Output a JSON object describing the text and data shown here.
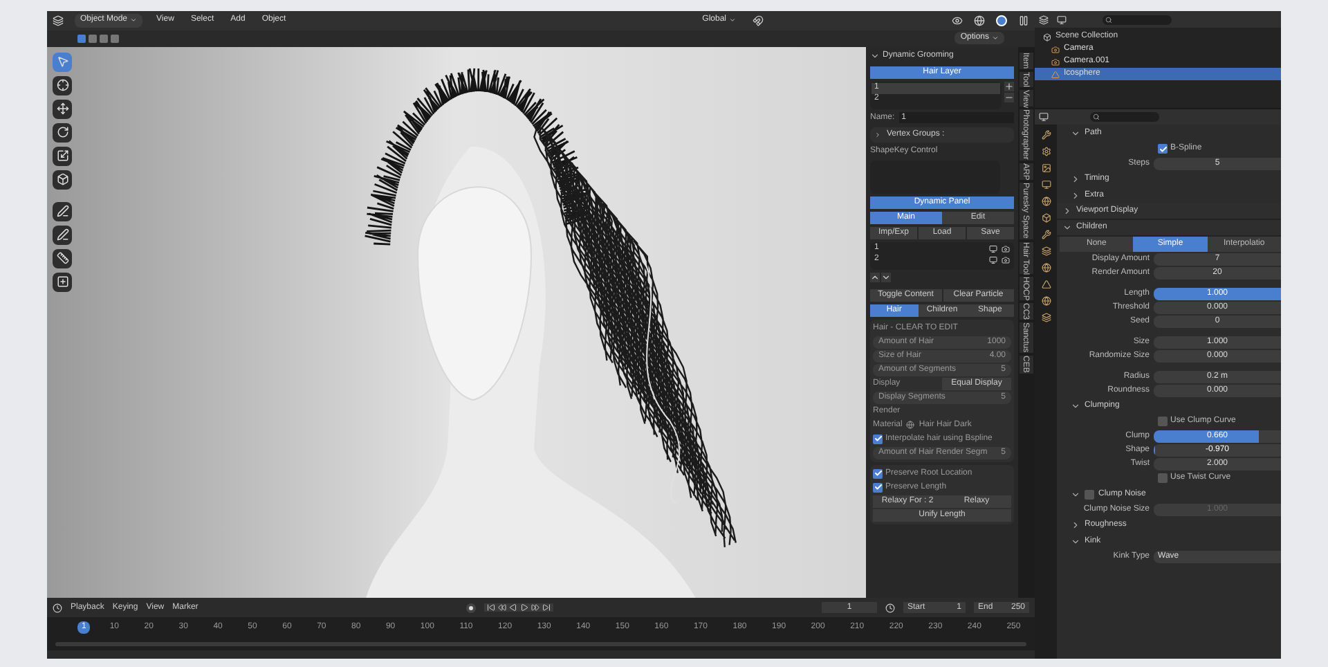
{
  "header": {
    "mode": "Object Mode",
    "menus": [
      "View",
      "Select",
      "Add",
      "Object"
    ],
    "orientation": "Global",
    "options": "Options"
  },
  "tools": [
    {
      "kind": "select",
      "selected": true
    },
    {
      "kind": "cursor",
      "selected": false
    },
    {
      "kind": "move",
      "selected": false
    },
    {
      "kind": "rotate",
      "selected": false
    },
    {
      "kind": "scale",
      "selected": false
    },
    {
      "kind": "transform",
      "selected": false
    },
    {
      "kind": "annotate",
      "selected": false
    },
    {
      "kind": "pen",
      "selected": false
    },
    {
      "kind": "measure",
      "selected": false
    },
    {
      "kind": "add",
      "selected": false
    }
  ],
  "grooming": {
    "title": "Dynamic Grooming",
    "layer_button": "Hair Layer",
    "layers": [
      {
        "name": "1",
        "selected": true
      },
      {
        "name": "2",
        "selected": false
      }
    ],
    "name_label": "Name:",
    "name_value": "1",
    "vertex_groups": "Vertex Groups :",
    "shapekey": "ShapeKey Control",
    "dynamic_panel": "Dynamic Panel",
    "tabs": [
      {
        "label": "Main",
        "selected": true
      },
      {
        "label": "Edit",
        "selected": false
      }
    ],
    "buttons": [
      "Imp/Exp",
      "Load",
      "Save"
    ],
    "particles": [
      {
        "name": "1"
      },
      {
        "name": "2"
      }
    ],
    "toggle": "Toggle Content",
    "clear": "Clear Particle",
    "hair_tabs": [
      {
        "label": "Hair",
        "selected": true
      },
      {
        "label": "Children",
        "selected": false
      },
      {
        "label": "Shape",
        "selected": false
      }
    ],
    "hair_title": "Hair - CLEAR TO EDIT",
    "hair_fields": [
      {
        "label": "Amount of Hair",
        "value": "1000"
      },
      {
        "label": "Size of Hair",
        "value": "4.00"
      },
      {
        "label": "Amount of Segments",
        "value": "5"
      }
    ],
    "display_label": "Display",
    "equal_display": "Equal Display",
    "display_segments": {
      "label": "Display Segments",
      "value": "5"
    },
    "render_label": "Render",
    "material_label": "Material",
    "material": "Hair Hair Dark",
    "interpolate": {
      "label": "Interpolate hair using Bspline",
      "checked": true
    },
    "render_segments": {
      "label": "Amount of Hair Render Segm",
      "value": "5"
    },
    "preserve": [
      {
        "label": "Preserve Root Location",
        "checked": true
      },
      {
        "label": "Preserve Length",
        "checked": true
      }
    ],
    "relax_for": "Relaxy For : 2",
    "relax": "Relaxy",
    "unify": "Unify Length"
  },
  "side_tabs": [
    "Item",
    "Tool",
    "View",
    "Photographer",
    "ARP",
    "Puresky Space",
    "Hair Tool",
    "HOCP",
    "CC3",
    "Sanctus",
    "CEB"
  ],
  "outliner": {
    "root": "Scene Collection",
    "items": [
      {
        "name": "Camera",
        "kind": "camera",
        "selected": false
      },
      {
        "name": "Camera.001",
        "kind": "camera",
        "selected": false
      },
      {
        "name": "Icosphere",
        "kind": "mesh",
        "selected": true
      }
    ]
  },
  "properties": [
    {
      "kind": "subsection",
      "label": "Path",
      "expanded": true
    },
    {
      "kind": "check",
      "label": "B-Spline",
      "checked": true
    },
    {
      "kind": "field",
      "label": "Steps",
      "value": "5"
    },
    {
      "kind": "subsection",
      "label": "Timing",
      "expanded": false
    },
    {
      "kind": "subsection",
      "label": "Extra",
      "expanded": false
    },
    {
      "kind": "section",
      "label": "Viewport Display",
      "expanded": false
    },
    {
      "kind": "section",
      "label": "Children",
      "expanded": true
    },
    {
      "kind": "tabs",
      "options": [
        {
          "label": "None",
          "selected": false
        },
        {
          "label": "Simple",
          "selected": true
        },
        {
          "label": "Interpolatio",
          "selected": false
        }
      ]
    },
    {
      "kind": "field",
      "label": "Display Amount",
      "value": "7"
    },
    {
      "kind": "field",
      "label": "Render Amount",
      "value": "20"
    },
    {
      "kind": "gap"
    },
    {
      "kind": "slider",
      "label": "Length",
      "value": "1.000",
      "level": 1
    },
    {
      "kind": "field",
      "label": "Threshold",
      "value": "0.000"
    },
    {
      "kind": "field",
      "label": "Seed",
      "value": "0"
    },
    {
      "kind": "gap"
    },
    {
      "kind": "field",
      "label": "Size",
      "value": "1.000"
    },
    {
      "kind": "field",
      "label": "Randomize Size",
      "value": "0.000"
    },
    {
      "kind": "gap"
    },
    {
      "kind": "field",
      "label": "Radius",
      "value": "0.2 m"
    },
    {
      "kind": "field",
      "label": "Roundness",
      "value": "0.000"
    },
    {
      "kind": "subsection",
      "label": "Clumping",
      "expanded": true
    },
    {
      "kind": "check",
      "label": "Use Clump Curve",
      "checked": false
    },
    {
      "kind": "slider",
      "label": "Clump",
      "value": "0.660",
      "level": 0.83
    },
    {
      "kind": "slider",
      "label": "Shape",
      "value": "-0.970",
      "level": 0.015
    },
    {
      "kind": "field",
      "label": "Twist",
      "value": "2.000"
    },
    {
      "kind": "check",
      "label": "Use Twist Curve",
      "checked": false
    },
    {
      "kind": "subcheck",
      "label": "Clump Noise",
      "checked": false
    },
    {
      "kind": "disabled",
      "label": "Clump Noise Size",
      "value": "1.000"
    },
    {
      "kind": "subsection",
      "label": "Roughness",
      "expanded": false
    },
    {
      "kind": "subsection",
      "label": "Kink",
      "expanded": true
    },
    {
      "kind": "dropdown",
      "label": "Kink Type",
      "value": "Wave"
    }
  ],
  "timeline": {
    "menus": [
      "Playback",
      "Keying",
      "View",
      "Marker"
    ],
    "current_frame": "1",
    "start_label": "Start",
    "start": "1",
    "end_label": "End",
    "end": "250",
    "marker": "1",
    "ticks": [
      "10",
      "20",
      "30",
      "40",
      "50",
      "60",
      "70",
      "80",
      "90",
      "100",
      "110",
      "120",
      "130",
      "140",
      "150",
      "160",
      "170",
      "180",
      "190",
      "200",
      "210",
      "220",
      "230",
      "240",
      "250"
    ]
  }
}
